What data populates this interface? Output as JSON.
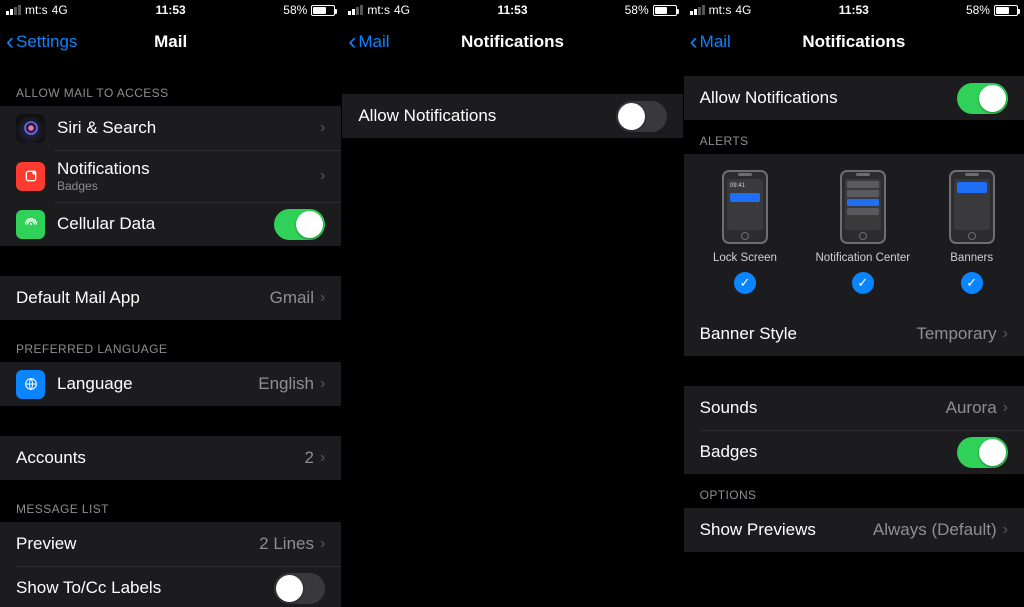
{
  "status": {
    "carrier": "mt:s",
    "net": "4G",
    "time": "11:53",
    "battery_pct": "58%"
  },
  "p1": {
    "back": "Settings",
    "title": "Mail",
    "sect_access": "Allow Mail to Access",
    "siri": "Siri & Search",
    "notifications": "Notifications",
    "notifications_sub": "Badges",
    "cellular": "Cellular Data",
    "default_app": "Default Mail App",
    "default_app_value": "Gmail",
    "sect_lang": "Preferred Language",
    "language": "Language",
    "language_value": "English",
    "accounts": "Accounts",
    "accounts_value": "2",
    "sect_msg": "Message List",
    "preview": "Preview",
    "preview_value": "2 Lines",
    "tocc": "Show To/Cc Labels"
  },
  "p2": {
    "back": "Mail",
    "title": "Notifications",
    "allow": "Allow Notifications"
  },
  "p3": {
    "back": "Mail",
    "title": "Notifications",
    "allow": "Allow Notifications",
    "sect_alerts": "Alerts",
    "tile_lock": "Lock Screen",
    "tile_nc": "Notification Center",
    "tile_ban": "Banners",
    "lock_time": "09:41",
    "banner_style": "Banner Style",
    "banner_style_value": "Temporary",
    "sounds": "Sounds",
    "sounds_value": "Aurora",
    "badges": "Badges",
    "sect_options": "Options",
    "show_previews": "Show Previews",
    "show_previews_value": "Always (Default)"
  }
}
